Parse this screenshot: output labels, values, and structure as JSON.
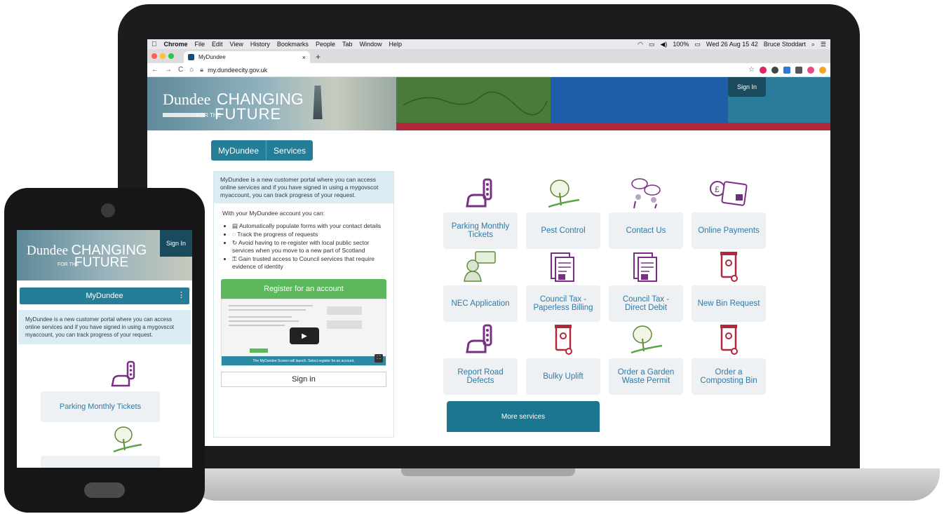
{
  "menubar": {
    "apple": "",
    "items": [
      "Chrome",
      "File",
      "Edit",
      "View",
      "History",
      "Bookmarks",
      "People",
      "Tab",
      "Window",
      "Help"
    ],
    "battery": "100%",
    "datetime": "Wed 26 Aug 15 42",
    "user": "Bruce Stoddart"
  },
  "browser": {
    "tab_title": "MyDundee",
    "tab_close": "×",
    "new_tab": "+",
    "url": "my.dundeecity.gov.uk",
    "star": "☆"
  },
  "site": {
    "logo_dundee": "Dundee",
    "logo_changing": "CHANGING",
    "logo_forthe": "FOR THE",
    "logo_future": "FUTURE",
    "signin": "Sign In",
    "nav": [
      "MyDundee",
      "Services"
    ],
    "intro": "MyDundee is a new customer portal where you can access online services and if you have signed in using a mygovscot myaccount, you can track progress of your request.",
    "features_heading": "With your MyDundee account you can:",
    "features": [
      "Automatically populate forms with your contact details",
      "Track the progress of requests",
      "Avoid having to re-register with local public sector services when you move to a new part of Scotland",
      "Gain trusted access to Council services that require evidence of identity"
    ],
    "register_label": "Register for an account",
    "video_caption": "The MyDundee Screen will launch. Select register for an account.",
    "signin_box": "Sign in",
    "services": [
      "Parking Monthly Tickets",
      "Pest Control",
      "Contact Us",
      "Online Payments",
      "NEC Application",
      "Council Tax - Paperless Billing",
      "Council Tax - Direct Debit",
      "New Bin Request",
      "Report Road Defects",
      "Bulky Uplift",
      "Order a Garden Waste Permit",
      "Order a Composting Bin"
    ],
    "more_services": "More services"
  },
  "phone": {
    "signin": "Sign In",
    "nav": "MyDundee",
    "intro": "MyDundee is a new customer portal where you can access online services and if you have signed in using a mygovscot myaccount, you can track progress of your request.",
    "tile1": "Parking Monthly Tickets"
  },
  "colors": {
    "accent": "#247e97",
    "link": "#2d7aa8",
    "register": "#5cb85c",
    "banner_green": "#4a7a3c",
    "banner_blue": "#1e5ea8",
    "banner_red": "#b0283a"
  }
}
